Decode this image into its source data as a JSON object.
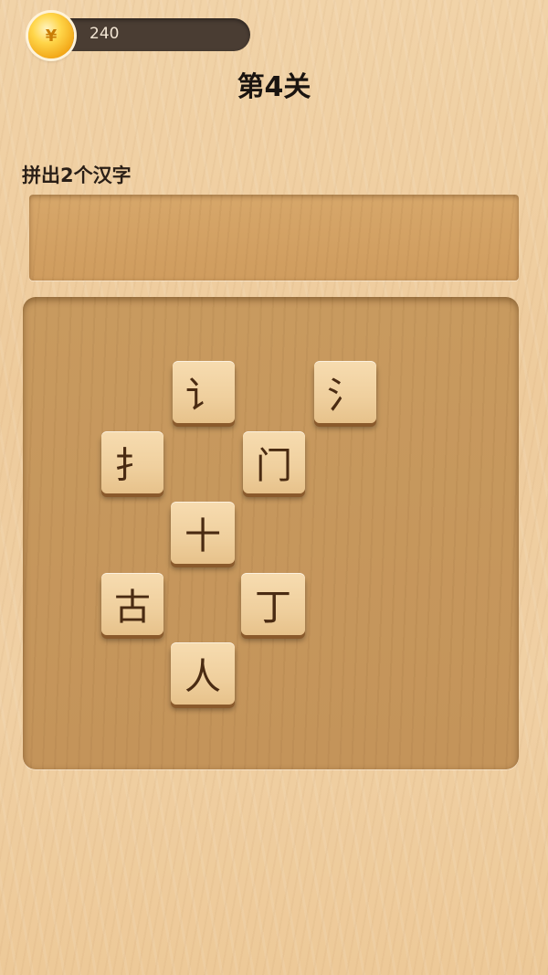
{
  "hud": {
    "coin_symbol": "¥",
    "coin_value": "240"
  },
  "level": {
    "title": "第4关"
  },
  "task": {
    "label": "拼出2个汉字"
  },
  "tiles": [
    "讠",
    "氵",
    "扌",
    "门",
    "十",
    "古",
    "丁",
    "人"
  ],
  "colors": {
    "hud_bar": "#4a3d33",
    "tile_face": "#efcf9d",
    "tile_text": "#4a2b12",
    "board": "#c4945a"
  }
}
